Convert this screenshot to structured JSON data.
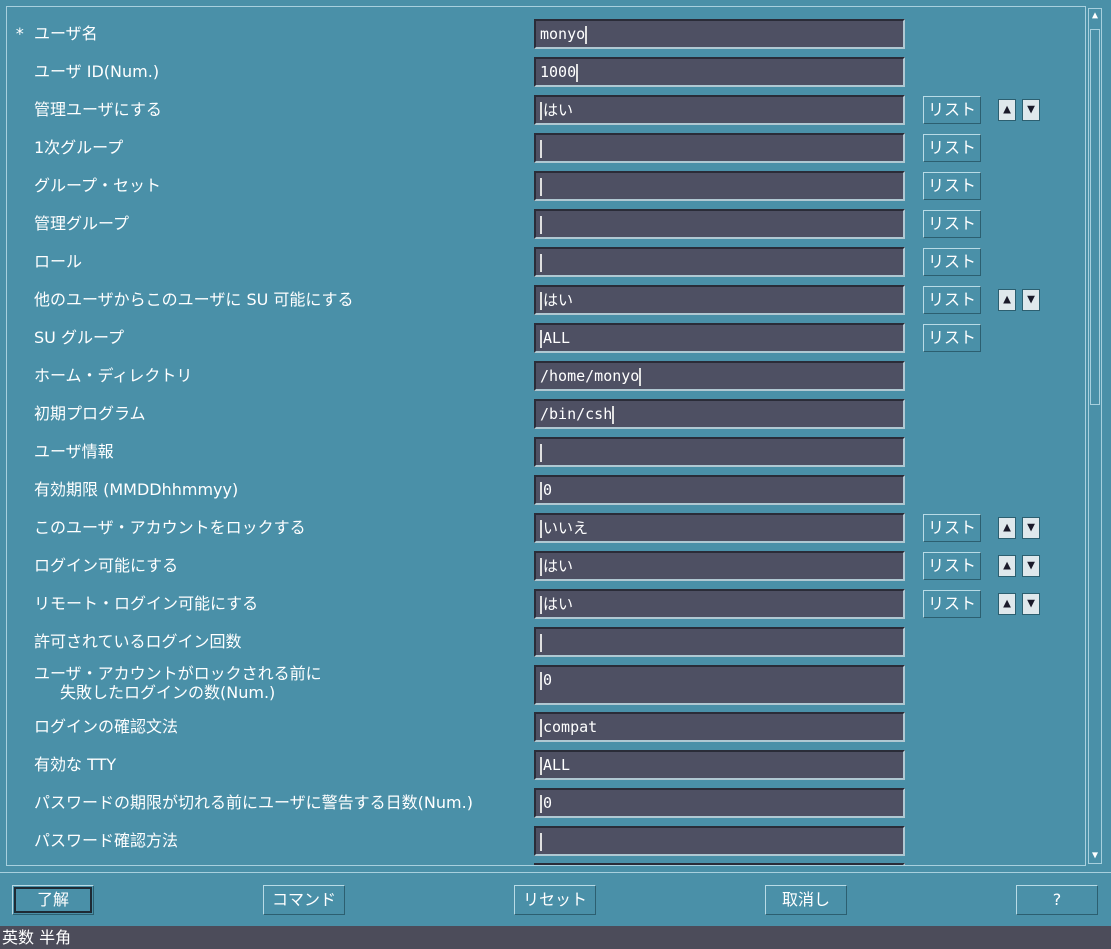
{
  "form": {
    "rows": [
      {
        "label": "ユーザ名",
        "required": "*",
        "value": "monyo"
      },
      {
        "label": "ユーザ ID(Num.)",
        "value": "1000"
      },
      {
        "label": "管理ユーザにする",
        "value": "はい"
      },
      {
        "label": "1次グループ",
        "value": ""
      },
      {
        "label": "グループ・セット",
        "value": ""
      },
      {
        "label": "管理グループ",
        "value": ""
      },
      {
        "label": "ロール",
        "value": ""
      },
      {
        "label": "他のユーザからこのユーザに SU 可能にする",
        "value": "はい"
      },
      {
        "label": "SU グループ",
        "value": "ALL"
      },
      {
        "label": "ホーム・ディレクトリ",
        "value": "/home/monyo"
      },
      {
        "label": "初期プログラム",
        "value": "/bin/csh"
      },
      {
        "label": "ユーザ情報",
        "value": ""
      },
      {
        "label": "有効期限 (MMDDhhmmyy)",
        "value": "0"
      },
      {
        "label": "このユーザ・アカウントをロックする",
        "value": "いいえ"
      },
      {
        "label": "ログイン可能にする",
        "value": "はい"
      },
      {
        "label": "リモート・ログイン可能にする",
        "value": "はい"
      },
      {
        "label": "許可されているログイン回数",
        "value": ""
      },
      {
        "label": "ユーザ・アカウントがロックされる前に",
        "label2": "失敗したログインの数(Num.)",
        "value": "0"
      },
      {
        "label": "ログインの確認文法",
        "value": "compat"
      },
      {
        "label": "有効な TTY",
        "value": "ALL"
      },
      {
        "label": "パスワードの期限が切れる前にユーザに警告する日数(Num.)",
        "value": "0"
      },
      {
        "label": "パスワード確認方法",
        "value": ""
      }
    ],
    "list_label": "リスト",
    "spin_up": "▲",
    "spin_down": "▼"
  },
  "buttons": {
    "ok": "了解",
    "command": "コマンド",
    "reset": "リセット",
    "cancel": "取消し",
    "help": "?"
  },
  "status": "英数 半角",
  "colors": {
    "background": "#4a90a8",
    "field": "#4e5063",
    "status_bar": "#4c4c5a"
  }
}
